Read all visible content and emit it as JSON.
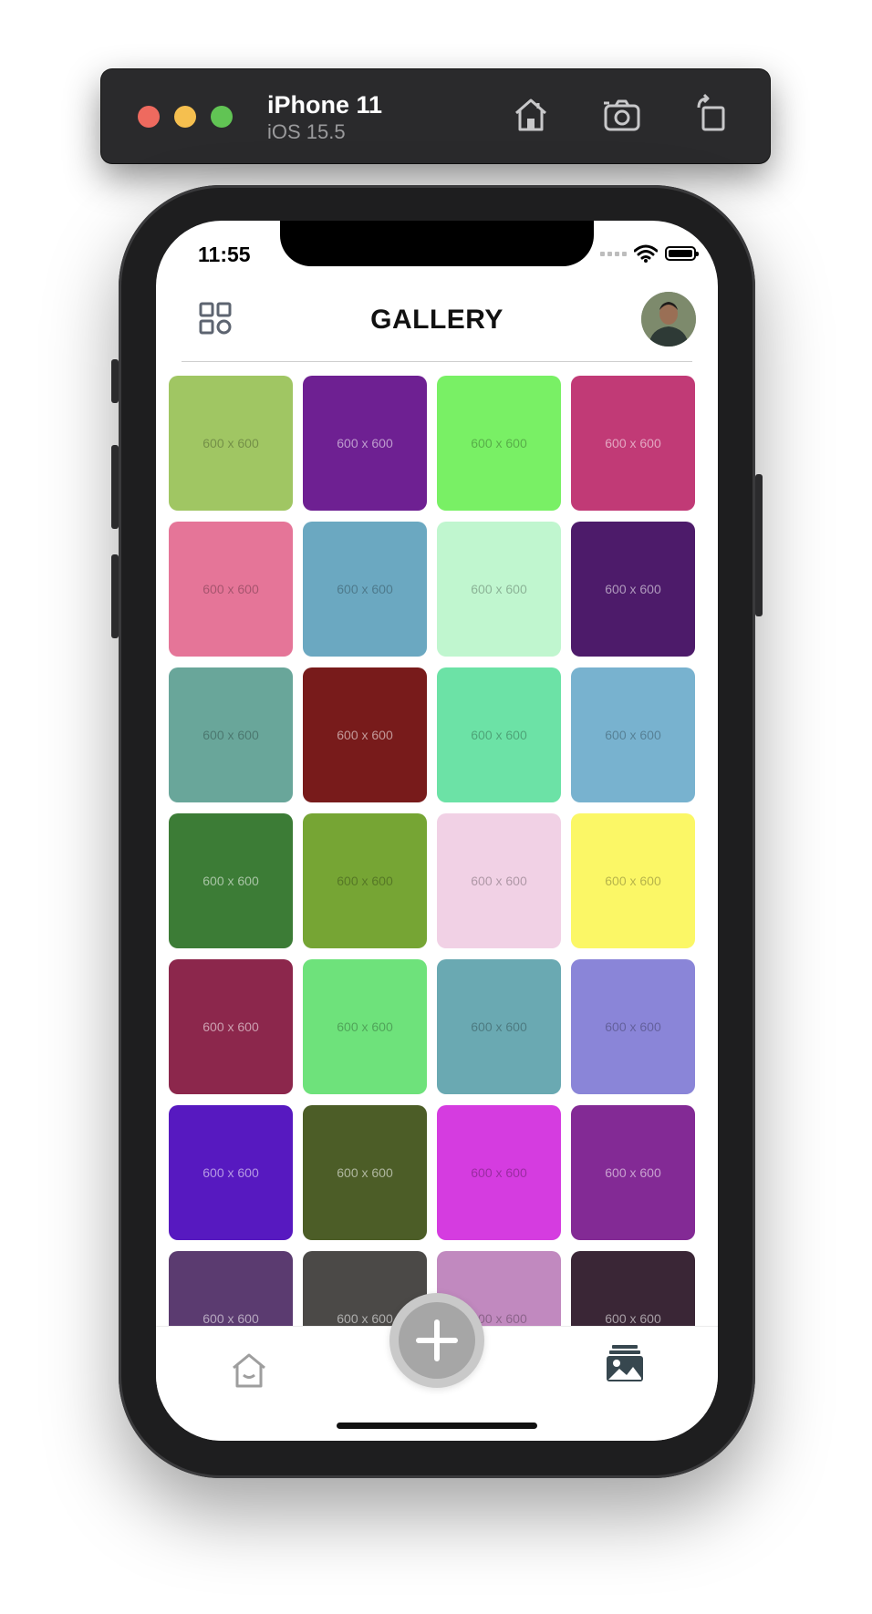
{
  "simulator": {
    "device_name": "iPhone 11",
    "os_version": "iOS 15.5",
    "icons": [
      "home-icon",
      "camera-icon",
      "rotate-icon"
    ]
  },
  "status_bar": {
    "time": "11:55"
  },
  "header": {
    "title": "GALLERY",
    "left_icon": "grid-menu-icon"
  },
  "gallery": {
    "placeholder_label": "600 x 600",
    "tiles": [
      {
        "color": "#a0c663",
        "label": "600 x 600"
      },
      {
        "color": "#6e2092",
        "label": "600 x 600"
      },
      {
        "color": "#79f065",
        "label": "600 x 600"
      },
      {
        "color": "#c13a76",
        "label": "600 x 600"
      },
      {
        "color": "#e57598",
        "label": "600 x 600"
      },
      {
        "color": "#6ba8c1",
        "label": "600 x 600"
      },
      {
        "color": "#c0f6cf",
        "label": "600 x 600"
      },
      {
        "color": "#4d1b6a",
        "label": "600 x 600"
      },
      {
        "color": "#69a69a",
        "label": "600 x 600"
      },
      {
        "color": "#781b1b",
        "label": "600 x 600"
      },
      {
        "color": "#6ce2a6",
        "label": "600 x 600"
      },
      {
        "color": "#78b2cf",
        "label": "600 x 600"
      },
      {
        "color": "#3c7c36",
        "label": "600 x 600"
      },
      {
        "color": "#76a534",
        "label": "600 x 600"
      },
      {
        "color": "#f1d1e5",
        "label": "600 x 600"
      },
      {
        "color": "#fbf766",
        "label": "600 x 600"
      },
      {
        "color": "#8c274c",
        "label": "600 x 600"
      },
      {
        "color": "#6ee27b",
        "label": "600 x 600"
      },
      {
        "color": "#6aa9b2",
        "label": "600 x 600"
      },
      {
        "color": "#8a85d8",
        "label": "600 x 600"
      },
      {
        "color": "#5719c0",
        "label": "600 x 600"
      },
      {
        "color": "#4c5d27",
        "label": "600 x 600"
      },
      {
        "color": "#d53ce0",
        "label": "600 x 600"
      },
      {
        "color": "#832a95",
        "label": "600 x 600"
      },
      {
        "color": "#5b3b70",
        "label": "600 x 600"
      },
      {
        "color": "#4b4947",
        "label": "600 x 600"
      },
      {
        "color": "#c189bf",
        "label": "600 x 600"
      },
      {
        "color": "#3a2636",
        "label": "600 x 600"
      }
    ]
  },
  "tab_bar": {
    "items": [
      {
        "name": "home-tab",
        "icon": "home-icon",
        "active": false
      },
      {
        "name": "add-button",
        "icon": "plus-icon",
        "active": false
      },
      {
        "name": "gallery-tab",
        "icon": "photos-icon",
        "active": true
      }
    ]
  }
}
